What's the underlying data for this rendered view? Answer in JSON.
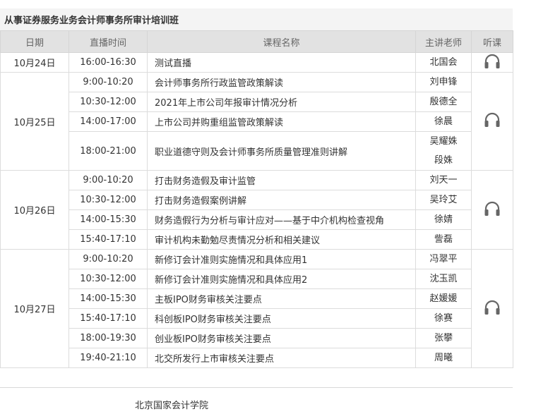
{
  "title": "从事证券服务业务会计师事务所审计培训班",
  "headers": {
    "date": "日期",
    "time": "直播时间",
    "course": "课程名称",
    "teacher": "主讲老师",
    "listen": "听课"
  },
  "days": [
    {
      "date": "10月24日",
      "sessions": [
        {
          "time": "16:00-16:30",
          "course": "测试直播",
          "teachers": [
            "北国会"
          ]
        }
      ]
    },
    {
      "date": "10月25日",
      "sessions": [
        {
          "time": "9:00-10:20",
          "course": "会计师事务所行政监管政策解读",
          "teachers": [
            "刘申锋"
          ]
        },
        {
          "time": "10:30-12:00",
          "course": "2021年上市公司年报审计情况分析",
          "teachers": [
            "殷德全"
          ]
        },
        {
          "time": "14:00-17:00",
          "course": "上市公司并购重组监管政策解读",
          "teachers": [
            "徐晨"
          ]
        },
        {
          "time": "18:00-21:00",
          "course": "职业道德守则及会计师事务所质量管理准则讲解",
          "teachers": [
            "吴耀姝",
            "段姝"
          ]
        }
      ]
    },
    {
      "date": "10月26日",
      "sessions": [
        {
          "time": "9:00-10:20",
          "course": "打击财务造假及审计监管",
          "teachers": [
            "刘天一"
          ]
        },
        {
          "time": "10:30-12:00",
          "course": "打击财务造假案例讲解",
          "teachers": [
            "吴玲艾"
          ]
        },
        {
          "time": "14:00-15:30",
          "course": "财务造假行为分析与审计应对——基于中介机构检查视角",
          "teachers": [
            "徐婧"
          ]
        },
        {
          "time": "15:40-17:10",
          "course": "审计机构未勤勉尽责情况分析和相关建议",
          "teachers": [
            "訾磊"
          ]
        }
      ]
    },
    {
      "date": "10月27日",
      "sessions": [
        {
          "time": "9:00-10:20",
          "course": "新修订会计准则实施情况和具体应用1",
          "teachers": [
            "冯翠平"
          ]
        },
        {
          "time": "10:30-12:00",
          "course": "新修订会计准则实施情况和具体应用2",
          "teachers": [
            "沈玉凯"
          ]
        },
        {
          "time": "14:00-15:30",
          "course": "主板IPO财务审核关注要点",
          "teachers": [
            "赵媛媛"
          ]
        },
        {
          "time": "15:40-17:10",
          "course": "科创板IPO财务审核关注要点",
          "teachers": [
            "徐赛"
          ]
        },
        {
          "time": "18:00-19:30",
          "course": "创业板IPO财务审核关注要点",
          "teachers": [
            "张攀"
          ]
        },
        {
          "time": "19:40-21:10",
          "course": "北交所发行上市审核关注要点",
          "teachers": [
            "周曦"
          ]
        }
      ]
    }
  ],
  "footer": "北京国家会计学院",
  "icons": {
    "listen": "headphones-icon"
  },
  "colors": {
    "header_bg": "#e2e2e2",
    "title_bg": "#f4f4f4",
    "border": "#dcdcdc",
    "icon": "#666666"
  }
}
